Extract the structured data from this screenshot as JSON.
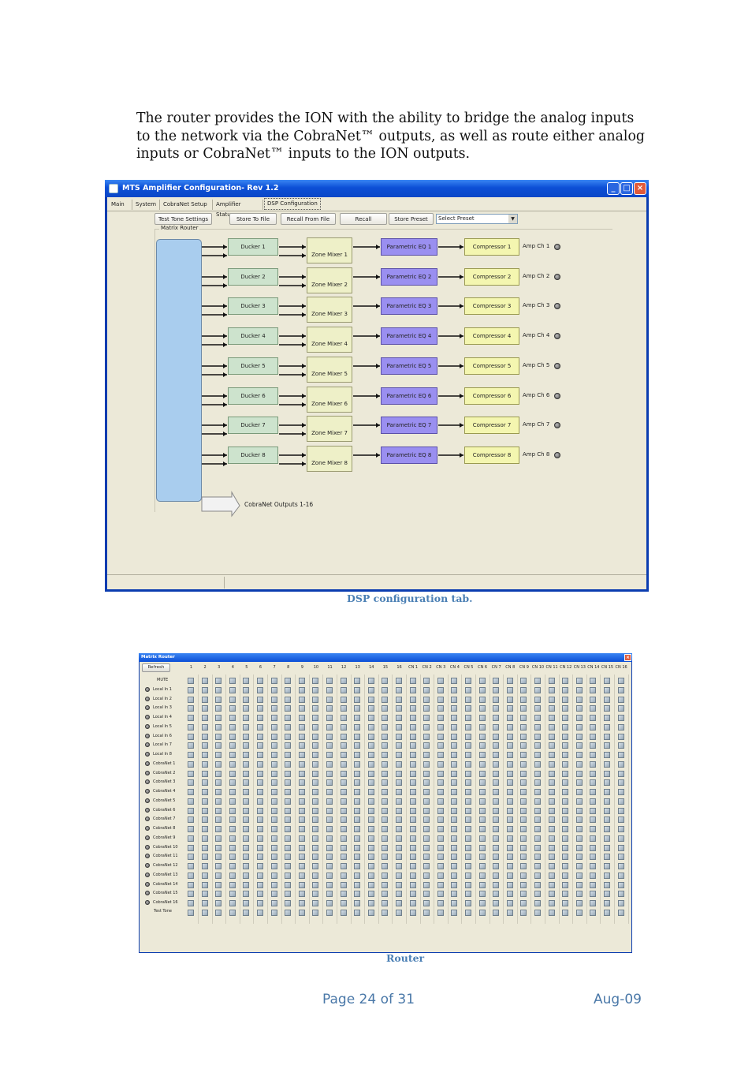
{
  "intro": "The router provides the ION with the ability to bridge the analog inputs to the network via the CobraNet™ outputs, as well as route either analog inputs or CobraNet™ inputs to the ION outputs.",
  "dsp_window": {
    "title": "MTS Amplifier Configuration- Rev 1.2",
    "tabs": [
      "Main",
      "System",
      "CobraNet Setup",
      "Amplifier Status",
      "DSP Configuration"
    ],
    "active_tab": "DSP Configuration",
    "toolbar": {
      "test_tone": "Test Tone Settings",
      "store_to_file": "Store To File",
      "recall_from_file": "Recall From File",
      "recall": "Recall",
      "store_preset": "Store Preset",
      "preset_select_value": "Select Preset"
    },
    "group_label": "Matrix Router",
    "duckers": [
      "Ducker 1",
      "Ducker 2",
      "Ducker 3",
      "Ducker 4",
      "Ducker 5",
      "Ducker 6",
      "Ducker 7",
      "Ducker 8"
    ],
    "zone_mixers": [
      "Zone Mixer 1",
      "Zone Mixer 2",
      "Zone Mixer 3",
      "Zone Mixer 4",
      "Zone Mixer 5",
      "Zone Mixer 6",
      "Zone Mixer 7",
      "Zone Mixer 8"
    ],
    "parametric_eqs": [
      "Parametric EQ 1",
      "Parametric EQ 2",
      "Parametric EQ 3",
      "Parametric EQ 4",
      "Parametric EQ 5",
      "Parametric EQ 6",
      "Parametric EQ 7",
      "Parametric EQ 8"
    ],
    "compressors": [
      "Compressor 1",
      "Compressor 2",
      "Compressor 3",
      "Compressor 4",
      "Compressor 5",
      "Compressor 6",
      "Compressor 7",
      "Compressor 8"
    ],
    "amp_channels": [
      "Amp Ch 1",
      "Amp Ch 2",
      "Amp Ch 3",
      "Amp Ch 4",
      "Amp Ch 5",
      "Amp Ch 6",
      "Amp Ch 7",
      "Amp Ch 8"
    ],
    "cobranet_outputs": "CobraNet Outputs 1-16"
  },
  "caption_dsp": "DSP configuration tab.",
  "router_window": {
    "title": "Matrix Router",
    "refresh": "Refresh",
    "columns": [
      "1",
      "2",
      "3",
      "4",
      "5",
      "6",
      "7",
      "8",
      "9",
      "10",
      "11",
      "12",
      "13",
      "14",
      "15",
      "16",
      "CN 1",
      "CN 2",
      "CN 3",
      "CN 4",
      "CN 5",
      "CN 6",
      "CN 7",
      "CN 8",
      "CN 9",
      "CN 10",
      "CN 11",
      "CN 12",
      "CN 13",
      "CN 14",
      "CN 15",
      "CN 16"
    ],
    "mute_label": "MUTE",
    "rows": [
      "Local In 1",
      "Local In 2",
      "Local In 3",
      "Local In 4",
      "Local In 5",
      "Local In 6",
      "Local In 7",
      "Local In 8",
      "CobraNet 1",
      "CobraNet 2",
      "CobraNet 3",
      "CobraNet 4",
      "CobraNet 5",
      "CobraNet 6",
      "CobraNet 7",
      "CobraNet 8",
      "CobraNet 9",
      "CobraNet 10",
      "CobraNet 11",
      "CobraNet 12",
      "CobraNet 13",
      "CobraNet 14",
      "CobraNet 15",
      "CobraNet 16"
    ],
    "test_tone": "Test Tone"
  },
  "caption_router": "Router",
  "footer": {
    "page": "Page 24 of 31",
    "date": "Aug-09"
  }
}
